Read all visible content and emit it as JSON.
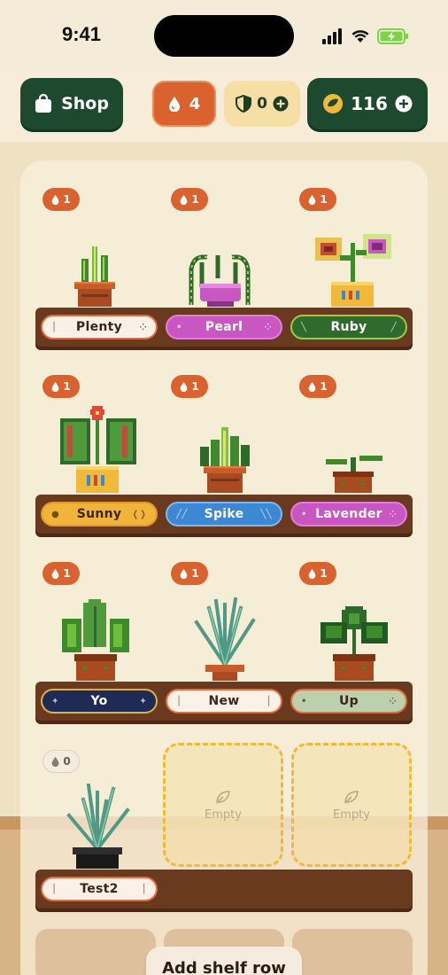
{
  "status": {
    "time": "9:41"
  },
  "topbar": {
    "shop_label": "Shop",
    "drops_count": "4",
    "shield_count": "0",
    "coins_count": "116"
  },
  "shelves": [
    {
      "slots": [
        {
          "badge": "1",
          "name": "Plenty",
          "tag_style": "cream"
        },
        {
          "badge": "1",
          "name": "Pearl",
          "tag_style": "pink"
        },
        {
          "badge": "1",
          "name": "Ruby",
          "tag_style": "green"
        }
      ]
    },
    {
      "slots": [
        {
          "badge": "1",
          "name": "Sunny",
          "tag_style": "yellow"
        },
        {
          "badge": "1",
          "name": "Spike",
          "tag_style": "blue"
        },
        {
          "badge": "1",
          "name": "Lavender",
          "tag_style": "pink"
        }
      ]
    },
    {
      "slots": [
        {
          "badge": "1",
          "name": "Yo",
          "tag_style": "navy"
        },
        {
          "badge": "1",
          "name": "New",
          "tag_style": "cream"
        },
        {
          "badge": "1",
          "name": "Up",
          "tag_style": "sage"
        }
      ]
    },
    {
      "slots": [
        {
          "badge": "0",
          "name": "Test2",
          "tag_style": "cream"
        },
        {
          "empty_label": "Empty"
        },
        {
          "empty_label": "Empty"
        }
      ]
    }
  ],
  "add_row_label": "Add shelf row",
  "colors": {
    "accent_orange": "#d9622f",
    "dark_green": "#1d4a2e",
    "shelf_brown": "#6a3a1f"
  },
  "icons": [
    "shopping-bag-icon",
    "water-drop-icon",
    "shield-icon",
    "plus-icon",
    "leaf-coin-icon",
    "leaf-icon"
  ]
}
